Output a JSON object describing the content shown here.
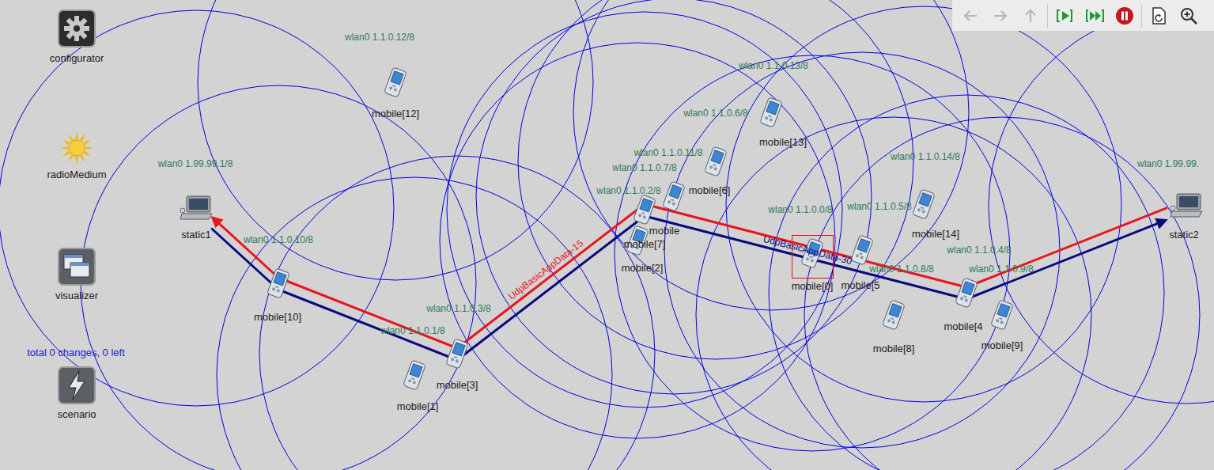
{
  "toolbar": {
    "buttons": [
      {
        "kind": "back",
        "disabled": true
      },
      {
        "kind": "forward",
        "disabled": true
      },
      {
        "kind": "up",
        "disabled": true
      },
      {
        "kind": "step",
        "disabled": false
      },
      {
        "kind": "run",
        "disabled": false
      },
      {
        "kind": "stop",
        "disabled": false
      },
      {
        "kind": "rebuild",
        "disabled": false
      },
      {
        "kind": "zoom",
        "disabled": false
      }
    ]
  },
  "palette": [
    {
      "label": "configurator",
      "kind": "gear"
    },
    {
      "label": "radioMedium",
      "kind": "sun"
    },
    {
      "label": "visualizer",
      "kind": "windows"
    },
    {
      "label": "scenario",
      "kind": "bolt"
    }
  ],
  "scenario_status": "total 0 changes, 0 left",
  "nodes": [
    {
      "label": "static1",
      "iface": "wlan0 1.99.99.1/8",
      "kind": "laptop",
      "selected": false
    },
    {
      "label": "mobile[10]",
      "iface": "wlan0 1.1.0.10/8",
      "kind": "pda",
      "selected": false
    },
    {
      "label": "mobile[3]",
      "iface": "wlan0 1.1.0.3/8",
      "kind": "pda",
      "selected": false
    },
    {
      "label": "mobile[1]",
      "iface": "wlan0 1.1.0.1/8",
      "kind": "pda",
      "selected": false
    },
    {
      "label": "mobile[12]",
      "iface": "wlan0 1.1.0.12/8",
      "kind": "pda",
      "selected": false
    },
    {
      "label": "mobile[7]",
      "iface": "wlan0 1.1.0.7/8",
      "kind": "pda",
      "selected": false
    },
    {
      "label": "mobile",
      "iface": "wlan0 1.1.0.11/8",
      "kind": "pda",
      "selected": false
    },
    {
      "label": "mobile[2]",
      "iface": "wlan0 1.1.0.2/8",
      "kind": "pda",
      "selected": false
    },
    {
      "label": "mobile[6]",
      "iface": "wlan0 1.1.0.6/8",
      "kind": "pda",
      "selected": false
    },
    {
      "label": "mobile[13]",
      "iface": "wlan0 1.1.0.13/8",
      "kind": "pda",
      "selected": false
    },
    {
      "label": "mobile[0]",
      "iface": "wlan0 1.1.0.0/8",
      "kind": "pda",
      "selected": true
    },
    {
      "label": "mobile[5",
      "iface": "wlan0 1.1.0.5/8",
      "kind": "pda",
      "selected": false
    },
    {
      "label": "mobile[14]",
      "iface": "wlan0 1.1.0.14/8",
      "kind": "pda",
      "selected": false
    },
    {
      "label": "mobile[8]",
      "iface": "wlan0 1.1.0.8/8",
      "kind": "pda",
      "selected": false
    },
    {
      "label": "mobile[4",
      "iface": "wlan0 1.1.0.4/8",
      "kind": "pda",
      "selected": false
    },
    {
      "label": "mobile[9]",
      "iface": "wlan0 1.1.0.9/8",
      "kind": "pda",
      "selected": false
    },
    {
      "label": "static2",
      "iface": "wlan0 1.99.99.",
      "kind": "laptop",
      "selected": false
    }
  ],
  "routes": [
    {
      "label": "UdpBasicAppData-15",
      "color": "#e8161f",
      "hops": [
        16,
        14,
        5,
        2,
        1,
        0
      ]
    },
    {
      "label": "UdpBasicAppData-30",
      "color": "#0a0a80",
      "hops": [
        0,
        1,
        2,
        5,
        14,
        16
      ]
    }
  ]
}
